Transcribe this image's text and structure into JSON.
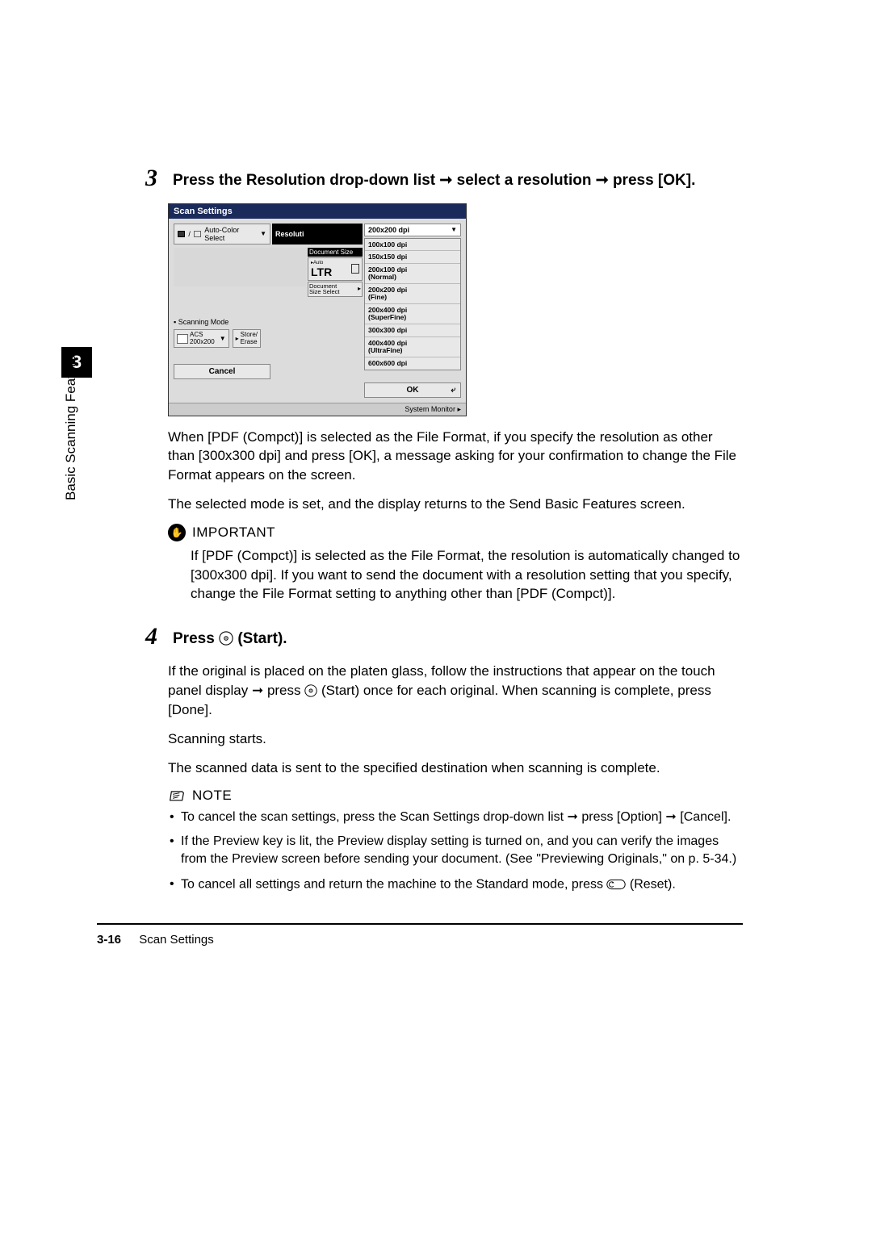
{
  "chapter_num": "3",
  "side_label": "Basic Scanning Features",
  "step3": {
    "num": "3",
    "title_a": "Press the Resolution drop-down list ",
    "title_b": " select a resolution ",
    "title_c": " press [OK]."
  },
  "screenshot": {
    "title": "Scan Settings",
    "auto_color": "Auto-Color Select",
    "resolution_label": "Resoluti",
    "selected": "200x200 dpi",
    "doc_size_label": "Document Size",
    "auto_small": "Auto",
    "ltr": "LTR",
    "doc_size_btn_l1": "Document",
    "doc_size_btn_l2": "Size Select",
    "scanning_mode": "Scanning Mode",
    "acs_l1": "ACS",
    "acs_l2": "200x200",
    "store_l1": "Store/",
    "store_l2": "Erase",
    "cancel": "Cancel",
    "ok": "OK",
    "sysmon": "System Monitor",
    "options": [
      "100x100 dpi",
      "150x150 dpi",
      "200x100 dpi (Normal)",
      "200x200 dpi (Fine)",
      "200x400 dpi (SuperFine)",
      "300x300 dpi",
      "400x400 dpi (UltraFine)",
      "600x600 dpi"
    ]
  },
  "para1": "When [PDF (Compct)] is selected as the File Format, if you specify the resolution as other than [300x300 dpi] and press [OK], a message asking for your confirmation to change the File Format appears on the screen.",
  "para2": "The selected mode is set, and the display returns to the Send Basic Features screen.",
  "important_label": "IMPORTANT",
  "important_text": "If [PDF (Compct)] is selected as the File Format, the resolution is automatically changed to [300x300 dpi]. If you want to send the document with a resolution setting that you specify, change the File Format setting to anything other than [PDF (Compct)].",
  "step4": {
    "num": "4",
    "title_a": "Press ",
    "title_b": " (Start)."
  },
  "para4a_a": "If the original is placed on the platen glass, follow the instructions that appear on the touch panel display ",
  "para4a_b": " press ",
  "para4a_c": " (Start) once for each original. When scanning is complete, press [Done].",
  "para4b": "Scanning starts.",
  "para4c": "The scanned data is sent to the specified destination when scanning is complete.",
  "note_label": "NOTE",
  "notes": {
    "n1_a": "To cancel the scan settings, press the Scan Settings drop-down list ",
    "n1_b": " press [Option] ",
    "n1_c": " [Cancel].",
    "n2": "If the Preview key is lit, the Preview display setting is turned on, and you can verify the images from the Preview screen before sending your document. (See \"Previewing Originals,\" on p. 5-34.)",
    "n3_a": "To cancel all settings and return the machine to the Standard mode, press ",
    "n3_b": " (Reset)."
  },
  "footer": {
    "page": "3-16",
    "section": "Scan Settings"
  }
}
